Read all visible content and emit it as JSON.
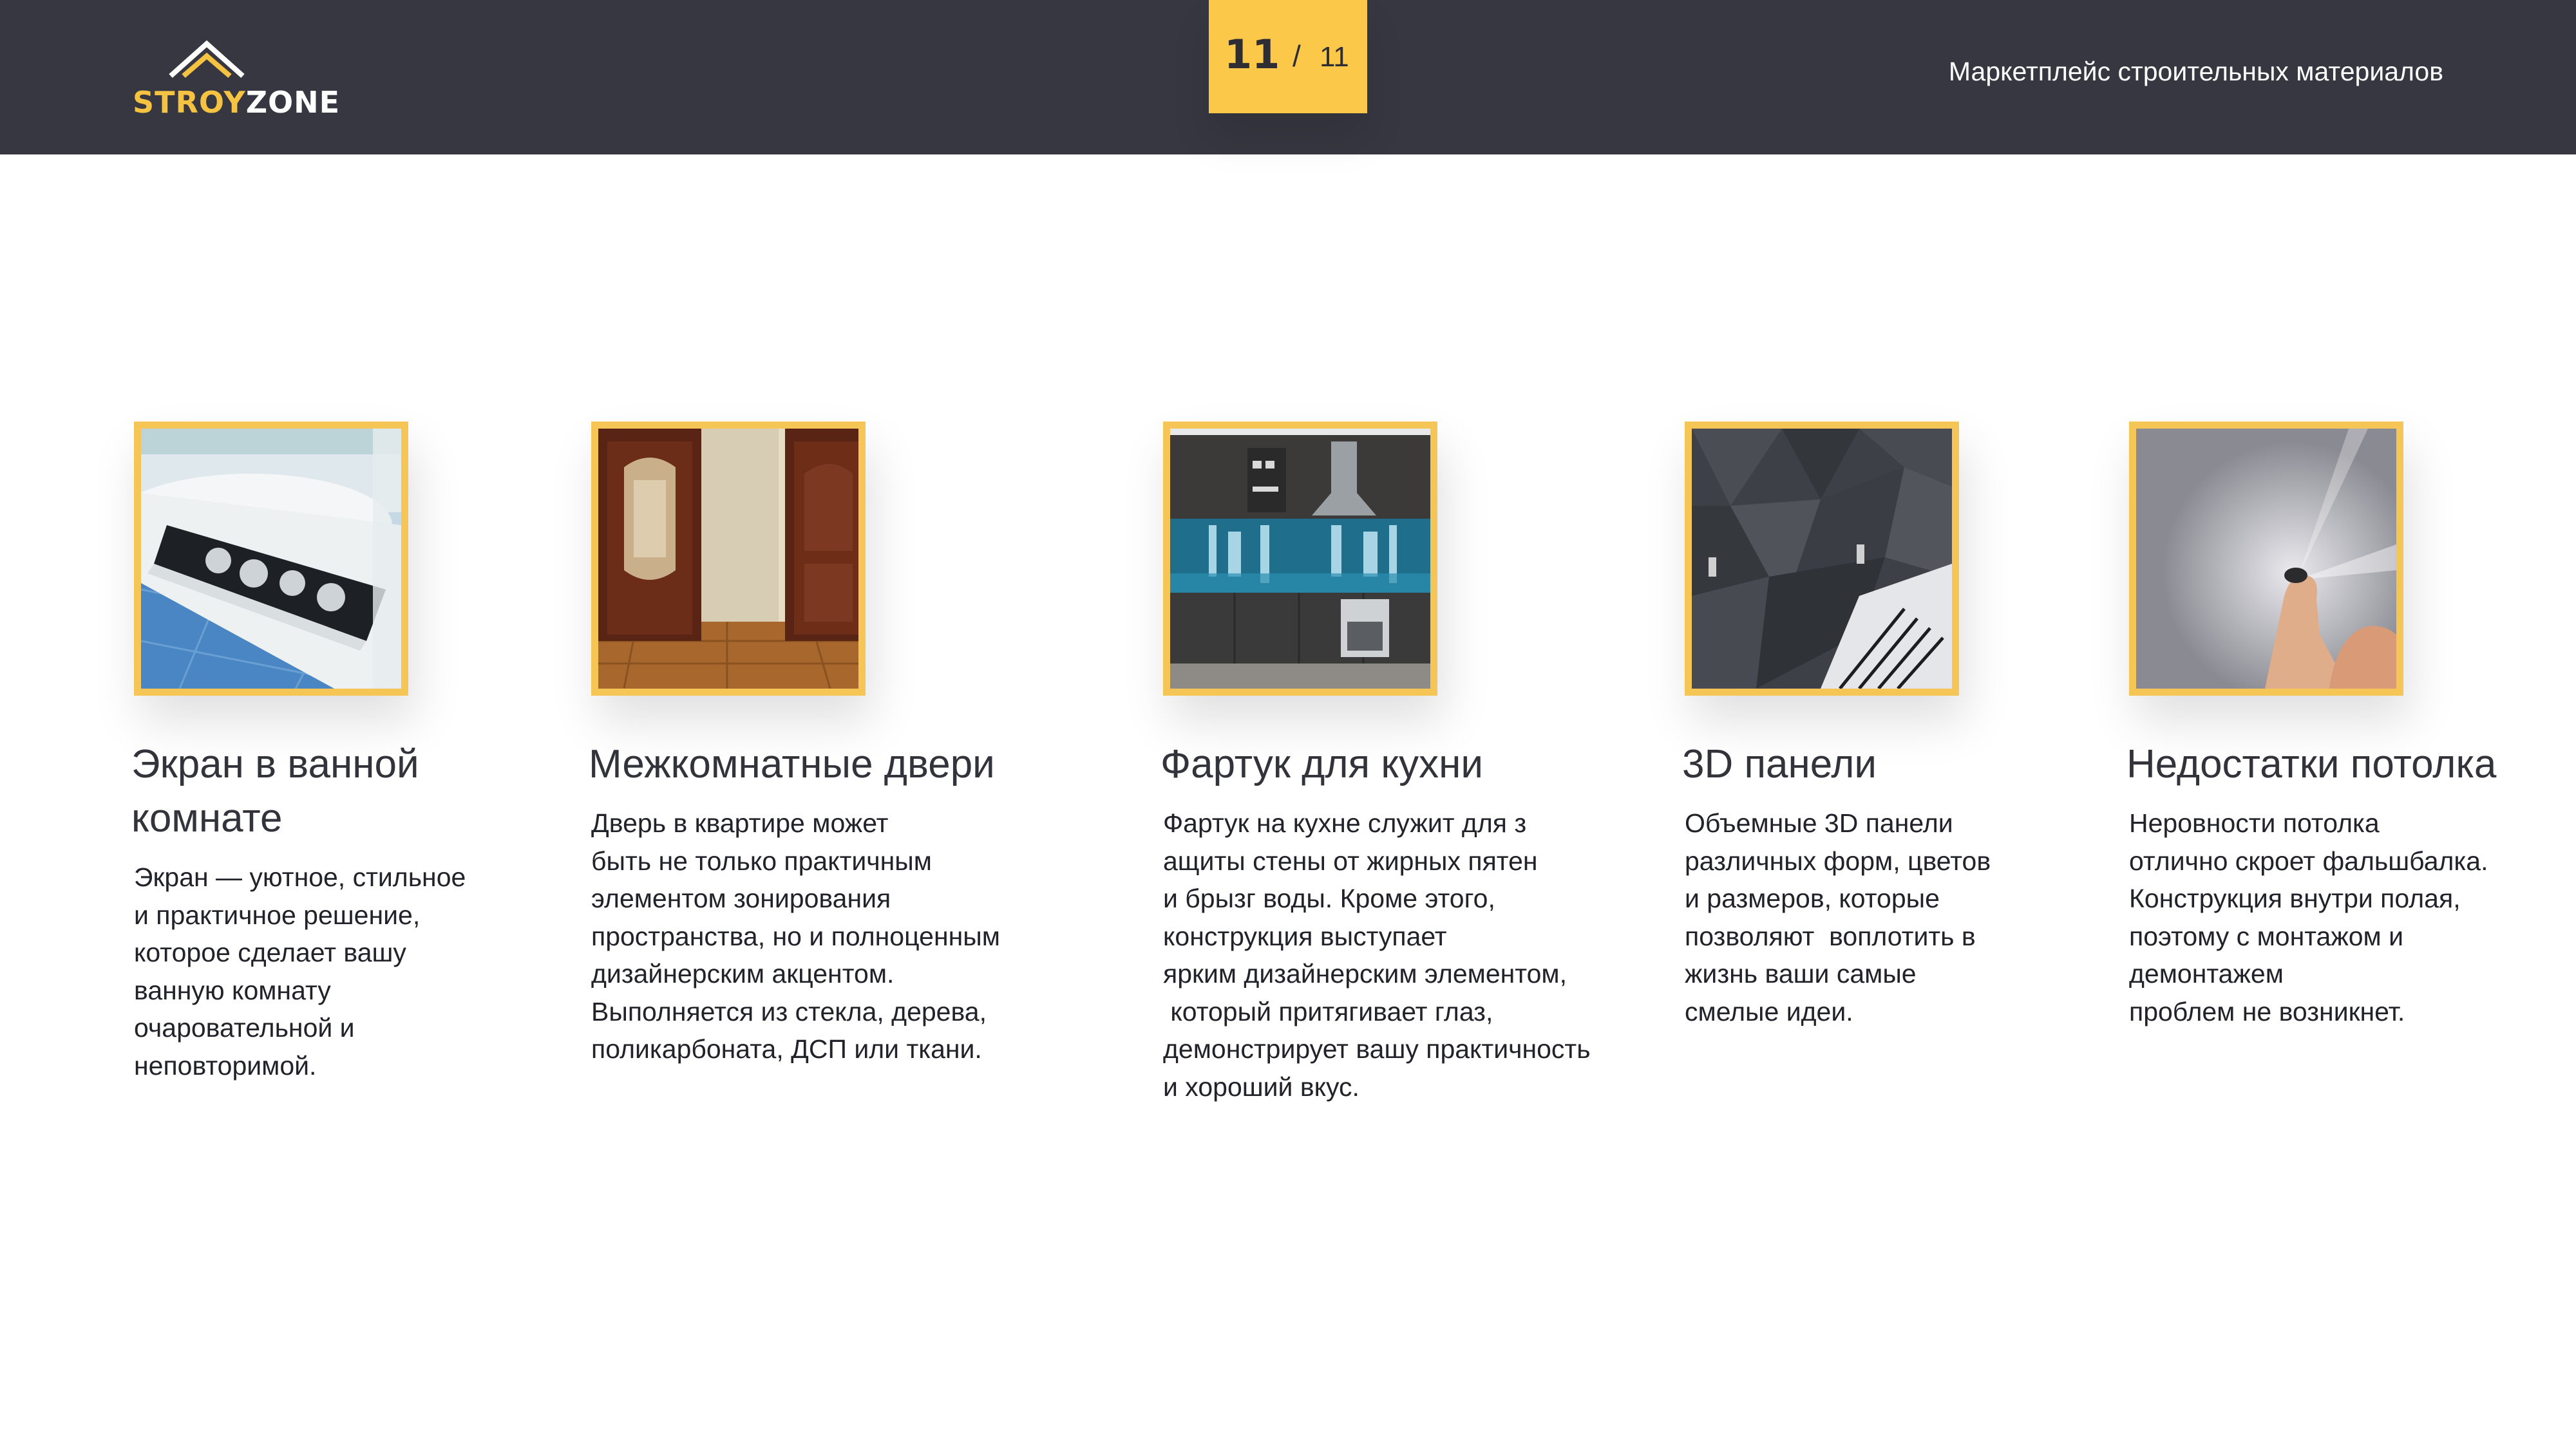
{
  "header": {
    "logo_part1": "STROY",
    "logo_part2": "ZONE",
    "page_current": "11",
    "page_separator": "/",
    "page_total": "11",
    "tagline": "Маркетплейс строительных материалов"
  },
  "colors": {
    "header_bg": "#363740",
    "accent": "#fbc849",
    "frame": "#f5c656"
  },
  "cards": [
    {
      "image": "bathtub-screen-photo",
      "title_lines": [
        "Экран в ванной",
        "комнате"
      ],
      "desc_lines": [
        "Экран — уютное, стильное",
        "и практичное решение,",
        "которое сделает вашу",
        "ванную комнату",
        "очаровательной и",
        "неповторимой."
      ]
    },
    {
      "image": "interior-doors-photo",
      "title_lines": [
        "Межкомнатные двери"
      ],
      "desc_lines": [
        "Дверь в квартире может",
        "быть не только практичным",
        "элементом зонирования",
        "пространства, но и полноценным",
        "дизайнерским акцентом.",
        "Выполняется из стекла, дерева,",
        "поликарбоната, ДСП или ткани."
      ]
    },
    {
      "image": "kitchen-backsplash-photo",
      "title_lines": [
        "Фартук для кухни"
      ],
      "desc_lines": [
        "Фартук на кухне служит для з",
        "ащиты стены от жирных пятен",
        "и брызг воды. Кроме этого,",
        "конструкция выступает",
        "ярким дизайнерским элементом,",
        " который притягивает глаз,",
        "демонстрирует вашу практичность",
        "и хороший вкус."
      ]
    },
    {
      "image": "3d-wall-panels-photo",
      "title_lines": [
        "3D панели"
      ],
      "desc_lines": [
        "Объемные 3D панели",
        "различных форм, цветов",
        "и размеров, которые",
        "позволяют  воплотить в",
        "жизнь ваши самые",
        "смелые идеи."
      ]
    },
    {
      "image": "ceiling-defects-photo",
      "title_lines": [
        "Недостатки потолка"
      ],
      "desc_lines": [
        "Неровности потолка",
        "отлично скроет фальшбалка.",
        "Конструкция внутри полая,",
        "поэтому с монтажом и",
        "демонтажем",
        "проблем не возникнет."
      ]
    }
  ]
}
